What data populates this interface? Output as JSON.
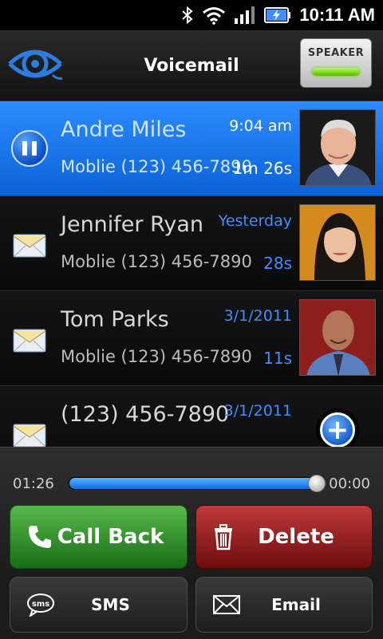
{
  "status_bar": {
    "time": "10:11 AM",
    "icons": [
      "bluetooth-icon",
      "wifi-icon",
      "signal-icon",
      "battery-charging-icon"
    ]
  },
  "header": {
    "logo_icon": "voicemail-eye-logo",
    "title": "Voicemail",
    "speaker_label": "SPEAKER"
  },
  "voicemails": [
    {
      "name": "Andre Miles",
      "phone": "Moblie (123) 456-7890",
      "date": "9:04 am",
      "duration": "1m 26s",
      "state": "playing",
      "icon": "pause-icon",
      "photo": "contact-photo-andre"
    },
    {
      "name": "Jennifer Ryan",
      "phone": "Moblie (123) 456-7890",
      "date": "Yesterday",
      "duration": "28s",
      "state": "unread",
      "icon": "envelope-icon",
      "photo": "contact-photo-jennifer"
    },
    {
      "name": "Tom Parks",
      "phone": "Moblie (123) 456-7890",
      "date": "3/1/2011",
      "duration": "11s",
      "state": "unread",
      "icon": "envelope-icon",
      "photo": "contact-photo-tom"
    },
    {
      "name": "(123) 456-7890",
      "phone": "",
      "date": "3/1/2011",
      "duration": "",
      "state": "unread",
      "icon": "envelope-icon",
      "photo": ""
    }
  ],
  "player": {
    "elapsed": "01:26",
    "remaining": "00:00",
    "progress": 1.0
  },
  "actions": {
    "call_back": "Call Back",
    "delete": "Delete",
    "sms": "SMS",
    "sms_icon_text": "sms",
    "email": "Email"
  },
  "colors": {
    "accent_blue": "#1a78f2",
    "call_green": "#2e8f25",
    "delete_red": "#9a1d1e",
    "date_blue": "#3e8eff"
  }
}
